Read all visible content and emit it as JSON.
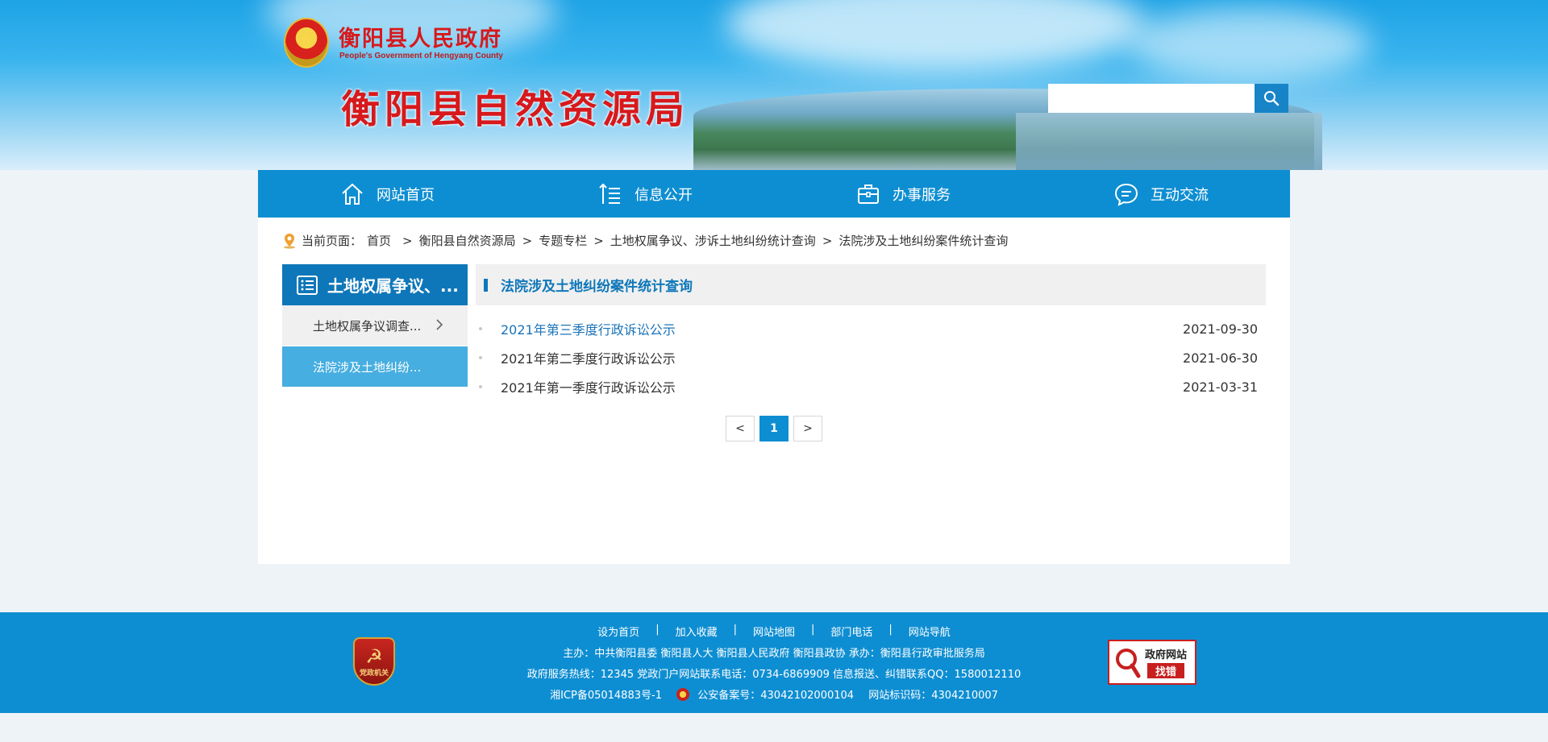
{
  "header": {
    "gov_name": "衡阳县人民政府",
    "gov_name_en": "People's Government of Hengyang County",
    "bureau_name": "衡阳县自然资源局",
    "search": {
      "placeholder": "",
      "value": ""
    }
  },
  "nav": {
    "items": [
      {
        "label": "网站首页",
        "icon": "home-icon"
      },
      {
        "label": "信息公开",
        "icon": "list-icon"
      },
      {
        "label": "办事服务",
        "icon": "briefcase-icon"
      },
      {
        "label": "互动交流",
        "icon": "chat-icon"
      }
    ]
  },
  "breadcrumb": {
    "prefix": "当前页面：",
    "items": [
      "首页",
      "衡阳县自然资源局",
      "专题专栏",
      "土地权属争议、涉诉土地纠纷统计查询",
      "法院涉及土地纠纷案件统计查询"
    ],
    "separator": ">"
  },
  "sidebar": {
    "title": "土地权属争议、...",
    "items": [
      {
        "label": "土地权属争议调查...",
        "active": false
      },
      {
        "label": "法院涉及土地纠纷...",
        "active": true
      }
    ]
  },
  "list": {
    "title": "法院涉及土地纠纷案件统计查询",
    "rows": [
      {
        "title": "2021年第三季度行政诉讼公示",
        "date": "2021-09-30"
      },
      {
        "title": "2021年第二季度行政诉讼公示",
        "date": "2021-06-30"
      },
      {
        "title": "2021年第一季度行政诉讼公示",
        "date": "2021-03-31"
      }
    ]
  },
  "pager": {
    "prev": "<",
    "current": "1",
    "next": ">"
  },
  "footer": {
    "links": [
      "设为首页",
      "加入收藏",
      "网站地图",
      "部门电话",
      "网站导航"
    ],
    "link_separator": "|",
    "sponsor": "主办：中共衡阳县委 衡阳县人大 衡阳县人民政府 衡阳县政协 承办：衡阳县行政审批服务局",
    "hotline": "政府服务热线：12345 党政门户网站联系电话：0734-6869909 信息报送、纠错联系QQ：1580012110",
    "icp": "湘ICP备05014883号-1",
    "police": "公安备案号：43042102000104",
    "site_code": "网站标识码：4304210007",
    "party_badge": "党政机关",
    "find_error_line1": "政府网站",
    "find_error_line2": "找错"
  },
  "colors": {
    "nav_bg": "#0e8ed2",
    "sidebar_title_bg": "#0e77b9",
    "sidebar_active_bg": "#46aee0",
    "title_red": "#d7191c"
  }
}
